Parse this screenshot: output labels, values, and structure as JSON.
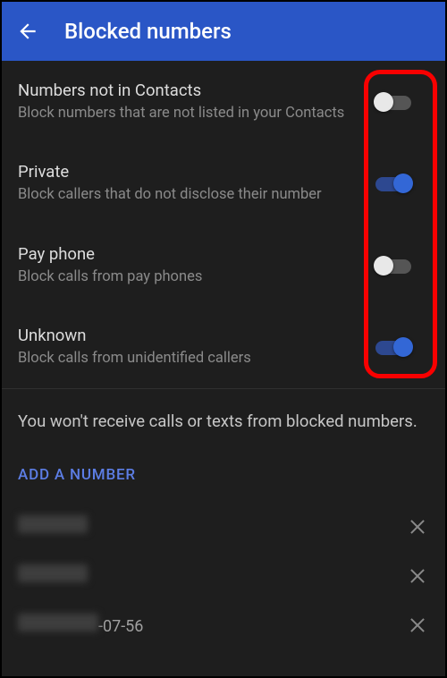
{
  "appbar": {
    "title": "Blocked numbers"
  },
  "settings": [
    {
      "title": "Numbers not in Contacts",
      "desc": "Block numbers that are not listed in your Contacts",
      "on": false
    },
    {
      "title": "Private",
      "desc": "Block callers that do not disclose their number",
      "on": true
    },
    {
      "title": "Pay phone",
      "desc": "Block calls from pay phones",
      "on": false
    },
    {
      "title": "Unknown",
      "desc": "Block calls from unidentified callers",
      "on": true
    }
  ],
  "info": "You won't receive calls or texts from blocked numbers.",
  "add_label": "ADD A NUMBER",
  "numbers": [
    {
      "display": "",
      "suffix": ""
    },
    {
      "display": "",
      "suffix": ""
    },
    {
      "display": "",
      "suffix": "-07-56"
    }
  ]
}
